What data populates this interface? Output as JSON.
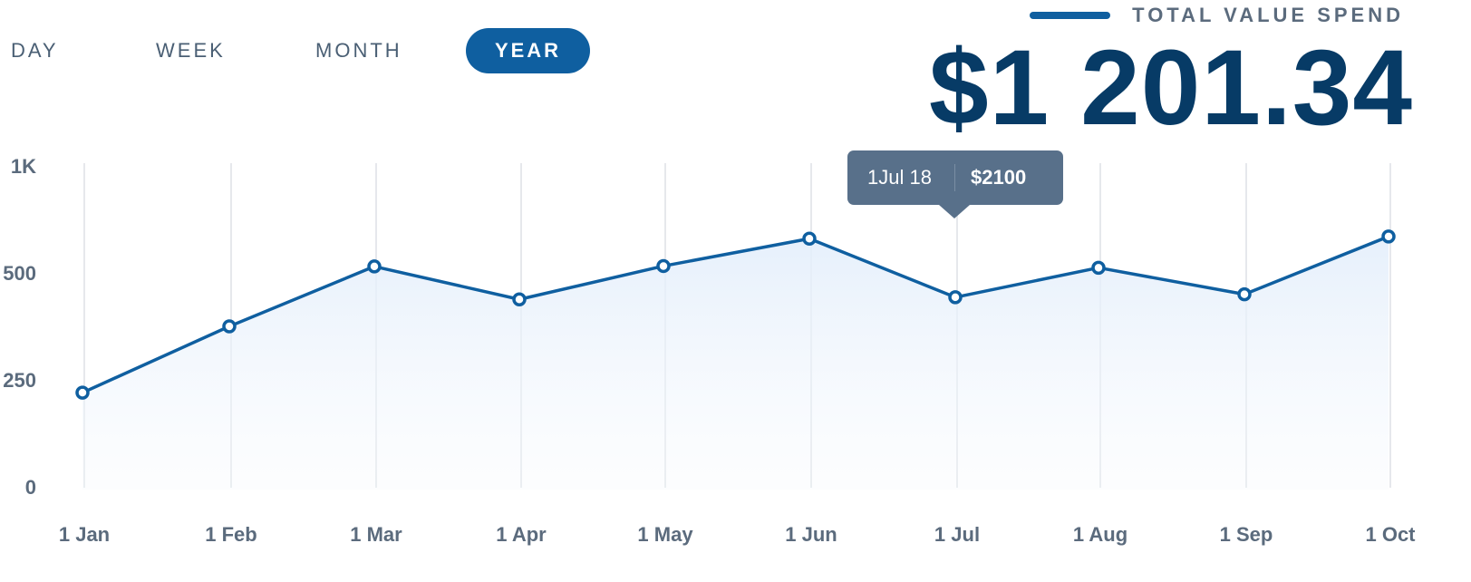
{
  "tabs": [
    {
      "label": "DAY"
    },
    {
      "label": "WEEK"
    },
    {
      "label": "MONTH"
    },
    {
      "label": "YEAR"
    }
  ],
  "active_tab": "YEAR",
  "legend_label": "TOTAL VALUE SPEND",
  "total_value": "$1 201.34",
  "tooltip": {
    "date": "1Jul 18",
    "value": "$2100"
  },
  "colors": {
    "accent": "#0f5fa0",
    "total": "#073b66",
    "tooltip_bg": "#58708a",
    "axis_text": "#5b6b7d",
    "grid": "#dde1e5"
  },
  "chart_data": {
    "type": "area",
    "categories": [
      "1 Jan",
      "1 Feb",
      "1 Mar",
      "1 Apr",
      "1 May",
      "1 Jun",
      "1 Jul",
      "1 Aug",
      "1 Sep",
      "1 Oct"
    ],
    "values": [
      220,
      375,
      530,
      438,
      532,
      660,
      443,
      524,
      450,
      670
    ],
    "y_ticks": [
      {
        "value": 0,
        "label": "0"
      },
      {
        "value": 250,
        "label": "250"
      },
      {
        "value": 500,
        "label": "500"
      },
      {
        "value": 1000,
        "label": "1K"
      }
    ],
    "ylim": [
      0,
      1000
    ],
    "grid": "vertical",
    "legend": "top-right"
  }
}
